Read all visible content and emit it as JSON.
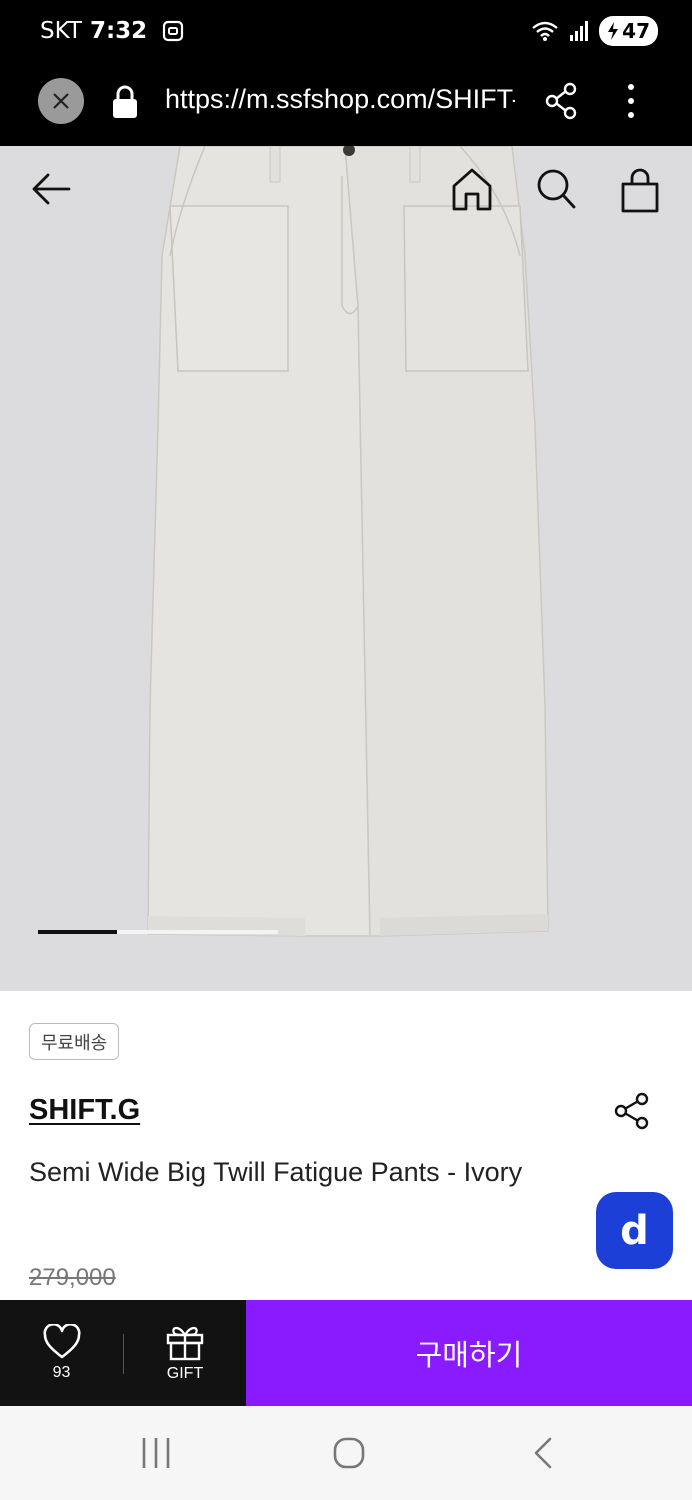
{
  "status_bar": {
    "carrier": "SKT",
    "time": "7:32",
    "battery": "47"
  },
  "browser": {
    "url": "https://m.ssfshop.com/SHIFT-G"
  },
  "product": {
    "image_alt": "Ivory wide pants",
    "gallery_progress": 0.33,
    "badge": "무료배송",
    "brand": "SHIFT.G",
    "name": "Semi Wide Big Twill Fatigue Pants - Ivory",
    "original_price": "279,000"
  },
  "fab": {
    "label": "d"
  },
  "action_bar": {
    "like_count": "93",
    "gift_label": "GIFT",
    "buy_label": "구매하기"
  },
  "colors": {
    "buy_button": "#8a1aff",
    "fab": "#1b3fd7",
    "action_bar_dark": "#121212",
    "hero_background": "#dcdcde"
  },
  "icons": [
    "close-icon",
    "lock-icon",
    "share-icon",
    "more-icon",
    "back-arrow-icon",
    "home-icon",
    "search-icon",
    "shopping-bag-icon",
    "heart-icon",
    "gift-icon",
    "recent-apps-icon",
    "home-circle-icon",
    "system-back-icon"
  ]
}
